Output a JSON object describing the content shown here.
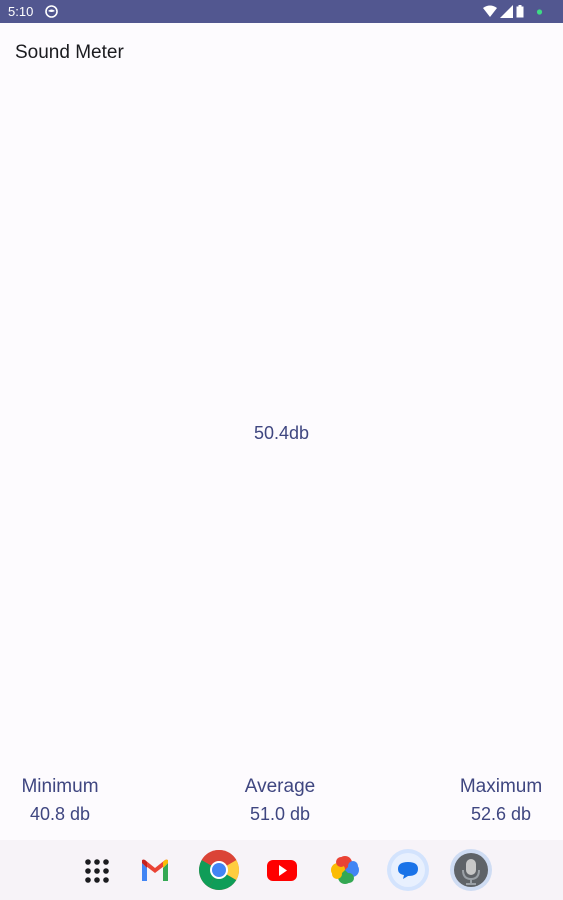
{
  "status_bar": {
    "time": "5:10",
    "icons": [
      "mask-icon",
      "wifi-icon",
      "signal-icon",
      "battery-icon",
      "dot-icon"
    ],
    "dot_color": "#3ddc84"
  },
  "app": {
    "title": "Sound Meter",
    "current_reading": "50.4db",
    "stats": {
      "minimum": {
        "label": "Minimum",
        "value": "40.8 db"
      },
      "average": {
        "label": "Average",
        "value": "51.0 db"
      },
      "maximum": {
        "label": "Maximum",
        "value": "52.6 db"
      }
    },
    "accent_color": "#3f4680"
  },
  "dock": {
    "items": [
      "app-drawer-icon",
      "gmail-icon",
      "chrome-icon",
      "youtube-icon",
      "photos-icon",
      "messages-icon",
      "sound-meter-app-icon"
    ]
  }
}
